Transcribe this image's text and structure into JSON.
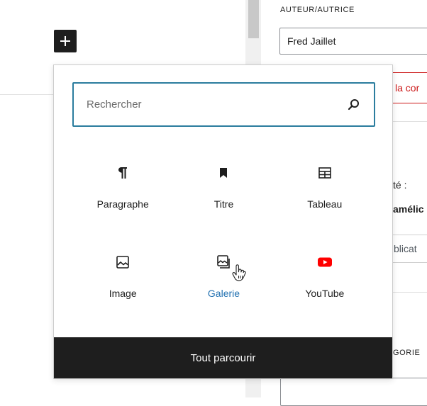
{
  "editor": {
    "add_block_icon": "plus-icon"
  },
  "sidebar": {
    "author_label": "AUTEUR/AUTRICE",
    "author_value": "Fred Jaillet",
    "notice_text": "la cor",
    "visibility_label": "té :",
    "improve_label": "amélic",
    "publish_button_text": "blicat",
    "category_label": "GORIE"
  },
  "inserter": {
    "search": {
      "placeholder": "Rechercher",
      "value": ""
    },
    "blocks": [
      {
        "label": "Paragraphe",
        "icon": "paragraph-icon"
      },
      {
        "label": "Titre",
        "icon": "heading-bookmark-icon"
      },
      {
        "label": "Tableau",
        "icon": "table-icon"
      },
      {
        "label": "Image",
        "icon": "image-icon"
      },
      {
        "label": "Galerie",
        "icon": "gallery-icon"
      },
      {
        "label": "YouTube",
        "icon": "youtube-icon"
      }
    ],
    "hovered_block": "Galerie",
    "browse_all_label": "Tout parcourir"
  },
  "colors": {
    "accent": "#2271b1",
    "search_border": "#2b7d9e",
    "notice_red": "#cc1818",
    "youtube_red": "#ff0000",
    "dark": "#1e1e1e"
  }
}
